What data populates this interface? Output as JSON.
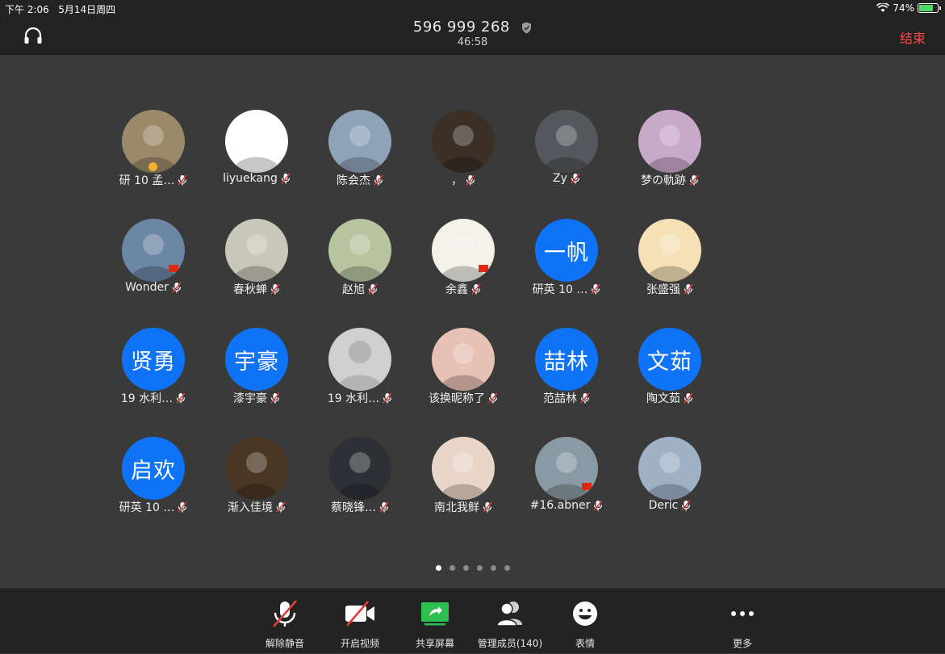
{
  "status_bar": {
    "time": "下午 2:06",
    "date": "5月14日周四",
    "battery": "74%"
  },
  "header": {
    "meeting_id": "596 999 268",
    "duration": "46:58",
    "end_label": "结束"
  },
  "participants": [
    {
      "name": "研 10 孟…",
      "avatar": "photo-desert-hand",
      "bg": "#9a8a6a",
      "badge": true
    },
    {
      "name": "liyuekang",
      "avatar": "photo-cartoon-goku",
      "bg": "#ffffff"
    },
    {
      "name": "陈会杰",
      "avatar": "photo-anime-couple",
      "bg": "#8fa3b8"
    },
    {
      "name": "，",
      "avatar": "photo-dark-sunset",
      "bg": "#3b2f26"
    },
    {
      "name": "Zy",
      "avatar": "photo-anime-dark-hair",
      "bg": "#55585c"
    },
    {
      "name": "梦の軌跡",
      "avatar": "photo-anime-girl-pink",
      "bg": "#c9a9c8"
    },
    {
      "name": "Wonder",
      "avatar": "photo-mountain-lake",
      "bg": "#6c86a6",
      "flag": true
    },
    {
      "name": "春秋蝉",
      "avatar": "photo-ink-painting",
      "bg": "#c9c7b9"
    },
    {
      "name": "赵旭",
      "avatar": "photo-anime-boy-sitting",
      "bg": "#b7c4a0"
    },
    {
      "name": "余鑫",
      "avatar": "photo-cartoon-boy",
      "bg": "#f4f1e9",
      "flag": true
    },
    {
      "name": "研英 10 …",
      "avatar_text": "一帆"
    },
    {
      "name": "张盛强",
      "avatar": "photo-crayon-shin",
      "bg": "#f5e1b5"
    },
    {
      "name": "19 水利…",
      "avatar_text": "贤勇"
    },
    {
      "name": "漆宇豪",
      "avatar_text": "宇豪"
    },
    {
      "name": "19 水利…",
      "avatar": "default-user",
      "bg": "#cfcfcf"
    },
    {
      "name": "该换昵称了",
      "avatar": "photo-man-red-mouth",
      "bg": "#e8c1b5"
    },
    {
      "name": "范喆林",
      "avatar_text": "喆林"
    },
    {
      "name": "陶文茹",
      "avatar_text": "文茹"
    },
    {
      "name": "研英 10 …",
      "avatar_text": "启欢"
    },
    {
      "name": "渐入佳境",
      "avatar": "photo-tea-cup",
      "bg": "#4a3723"
    },
    {
      "name": "蔡晓锋…",
      "avatar": "photo-helmet-robot",
      "bg": "#2f3036"
    },
    {
      "name": "南北我鲜",
      "avatar": "photo-girl-glasses",
      "bg": "#e9d6c8"
    },
    {
      "name": "#16.abner",
      "avatar": "photo-boy-outdoor",
      "bg": "#8a9aa5",
      "flag": true
    },
    {
      "name": "Deric",
      "avatar": "photo-trees-park",
      "bg": "#9fb1c4"
    }
  ],
  "pager": {
    "count": 6,
    "active": 0
  },
  "toolbar": [
    {
      "label": "解除静音",
      "icon": "mic-muted-icon"
    },
    {
      "label": "开启视频",
      "icon": "video-off-icon"
    },
    {
      "label": "共享屏幕",
      "icon": "share-screen-icon"
    },
    {
      "label": "管理成员(140)",
      "icon": "participants-icon"
    },
    {
      "label": "表情",
      "icon": "emoji-icon"
    },
    {
      "label": "更多",
      "icon": "more-icon"
    }
  ],
  "colors": {
    "accent": "#0e73f6",
    "end": "#ff4b45",
    "share": "#2dbf4f"
  }
}
